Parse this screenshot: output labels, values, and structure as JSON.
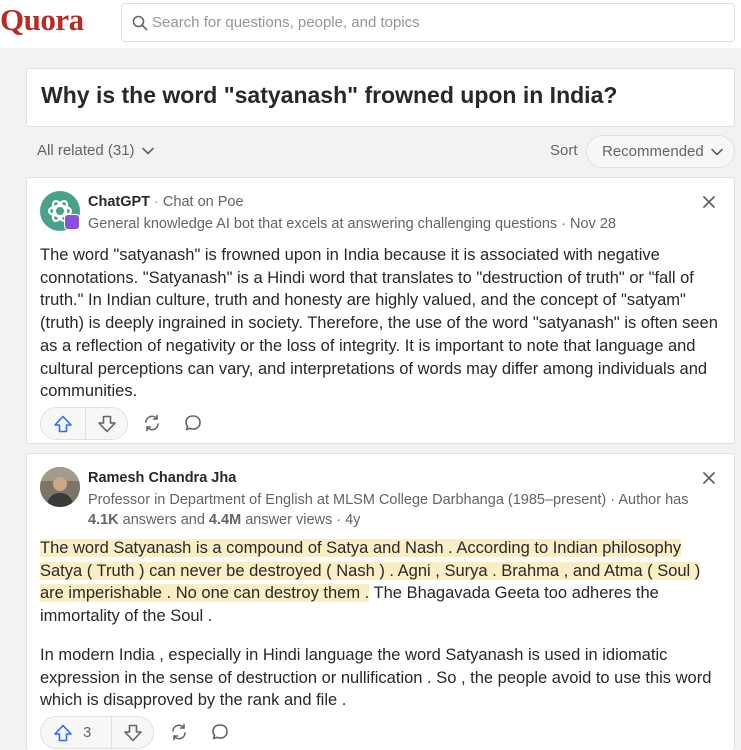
{
  "header": {
    "logo": "Quora",
    "search_placeholder": "Search for questions, people, and topics"
  },
  "question": {
    "title": "Why is the word \"satyanash\" frowned upon in India?"
  },
  "filters": {
    "all_related": "All related (31)",
    "sort_label": "Sort",
    "sort_value": "Recommended"
  },
  "answers": [
    {
      "author": "ChatGPT",
      "separator": " · ",
      "link": "Chat on Poe",
      "credential": "General knowledge AI bot that excels at answering challenging questions · Nov 28",
      "body": "The word \"satyanash\" is frowned upon in India because it is associated with negative connotations. \"Satyanash\" is a Hindi word that translates to \"destruction of truth\" or \"fall of truth.\" In Indian culture, truth and honesty are highly valued, and the concept of \"satyam\" (truth) is deeply ingrained in society. Therefore, the use of the word \"satyanash\" is often seen as a reflection of negativity or the loss of integrity. It is important to note that language and cultural perceptions can vary, and interpretations of words may differ among individuals and communities.",
      "upvotes": ""
    },
    {
      "author": "Ramesh Chandra Jha",
      "credential_prefix": "Professor in Department of English at MLSM College Darbhanga (1985–present) · Author has ",
      "answers_count": "4.1K",
      "answers_text": " answers and ",
      "views_count": "4.4M",
      "views_text": " answer views · 4y",
      "body_highlight": "The word Satyanash is a compound of Satya and Nash . According to Indian philosophy Satya ( Truth ) can never be destroyed ( Nash ) . Agni , Surya . Brahma , and Atma ( Soul ) are imperishable . No one can destroy them .",
      "body_rest": " The Bhagavada Geeta too adheres the immortality of the Soul .",
      "body_p2": "In modern India , especially in Hindi language the word Satyanash is used in idiomatic expression in the sense of destruction or nullification . So , the people avoid to use this word which is disapproved by the rank and file .",
      "upvotes": "3"
    }
  ],
  "icons": {
    "search": "search-icon",
    "chevron": "chevron-down-icon",
    "close": "close-icon",
    "upvote": "upvote-icon",
    "downvote": "downvote-icon",
    "share": "share-icon",
    "comment": "comment-icon"
  },
  "colors": {
    "brand": "#b92b27",
    "highlight": "#fbeec4",
    "upvote": "#2e69ff"
  }
}
